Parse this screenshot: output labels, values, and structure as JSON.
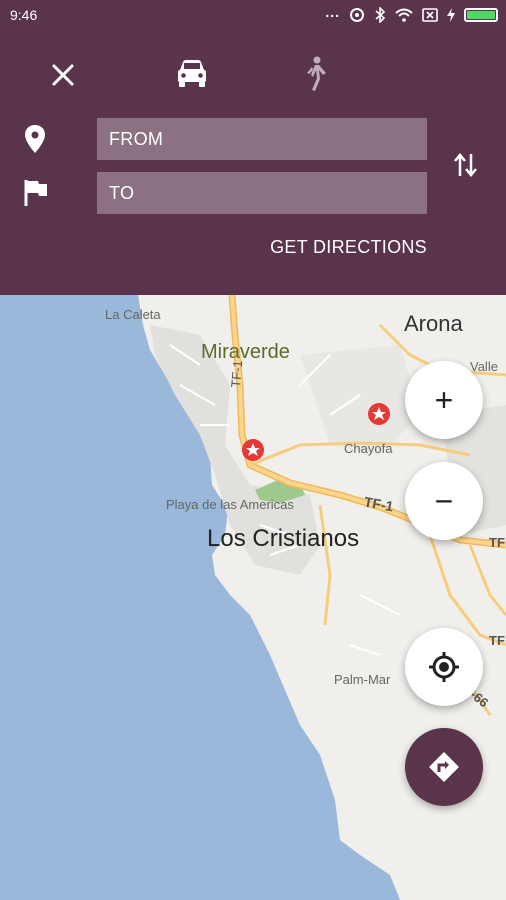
{
  "status_bar": {
    "time": "9:46",
    "more": "...",
    "battery_level": 1.0
  },
  "header": {
    "from_placeholder": "FROM",
    "to_placeholder": "TO",
    "get_directions_label": "GET DIRECTIONS",
    "modes": [
      "car",
      "walk"
    ],
    "selected_mode": "car"
  },
  "map": {
    "labels": {
      "la_caleta": "La Caleta",
      "arona": "Arona",
      "miraverde": "Miraverde",
      "valle": "Valle",
      "chayofa": "Chayofa",
      "playa": "Playa de las Americas",
      "los_cristianos": "Los Cristianos",
      "palm_mar": "Palm-Mar",
      "tf1_a": "TF-1",
      "tf1_b": "TF-1",
      "tf_edge_a": "TF",
      "tf_edge_b": "TF",
      "road_66": "-66"
    }
  },
  "controls": {
    "zoom_in": "+",
    "zoom_out": "−"
  },
  "colors": {
    "header": "#5a344b",
    "sea": "#9ab8d9",
    "land": "#f2f0ed",
    "highway": "#f5c56a",
    "marker": "#e53935"
  }
}
